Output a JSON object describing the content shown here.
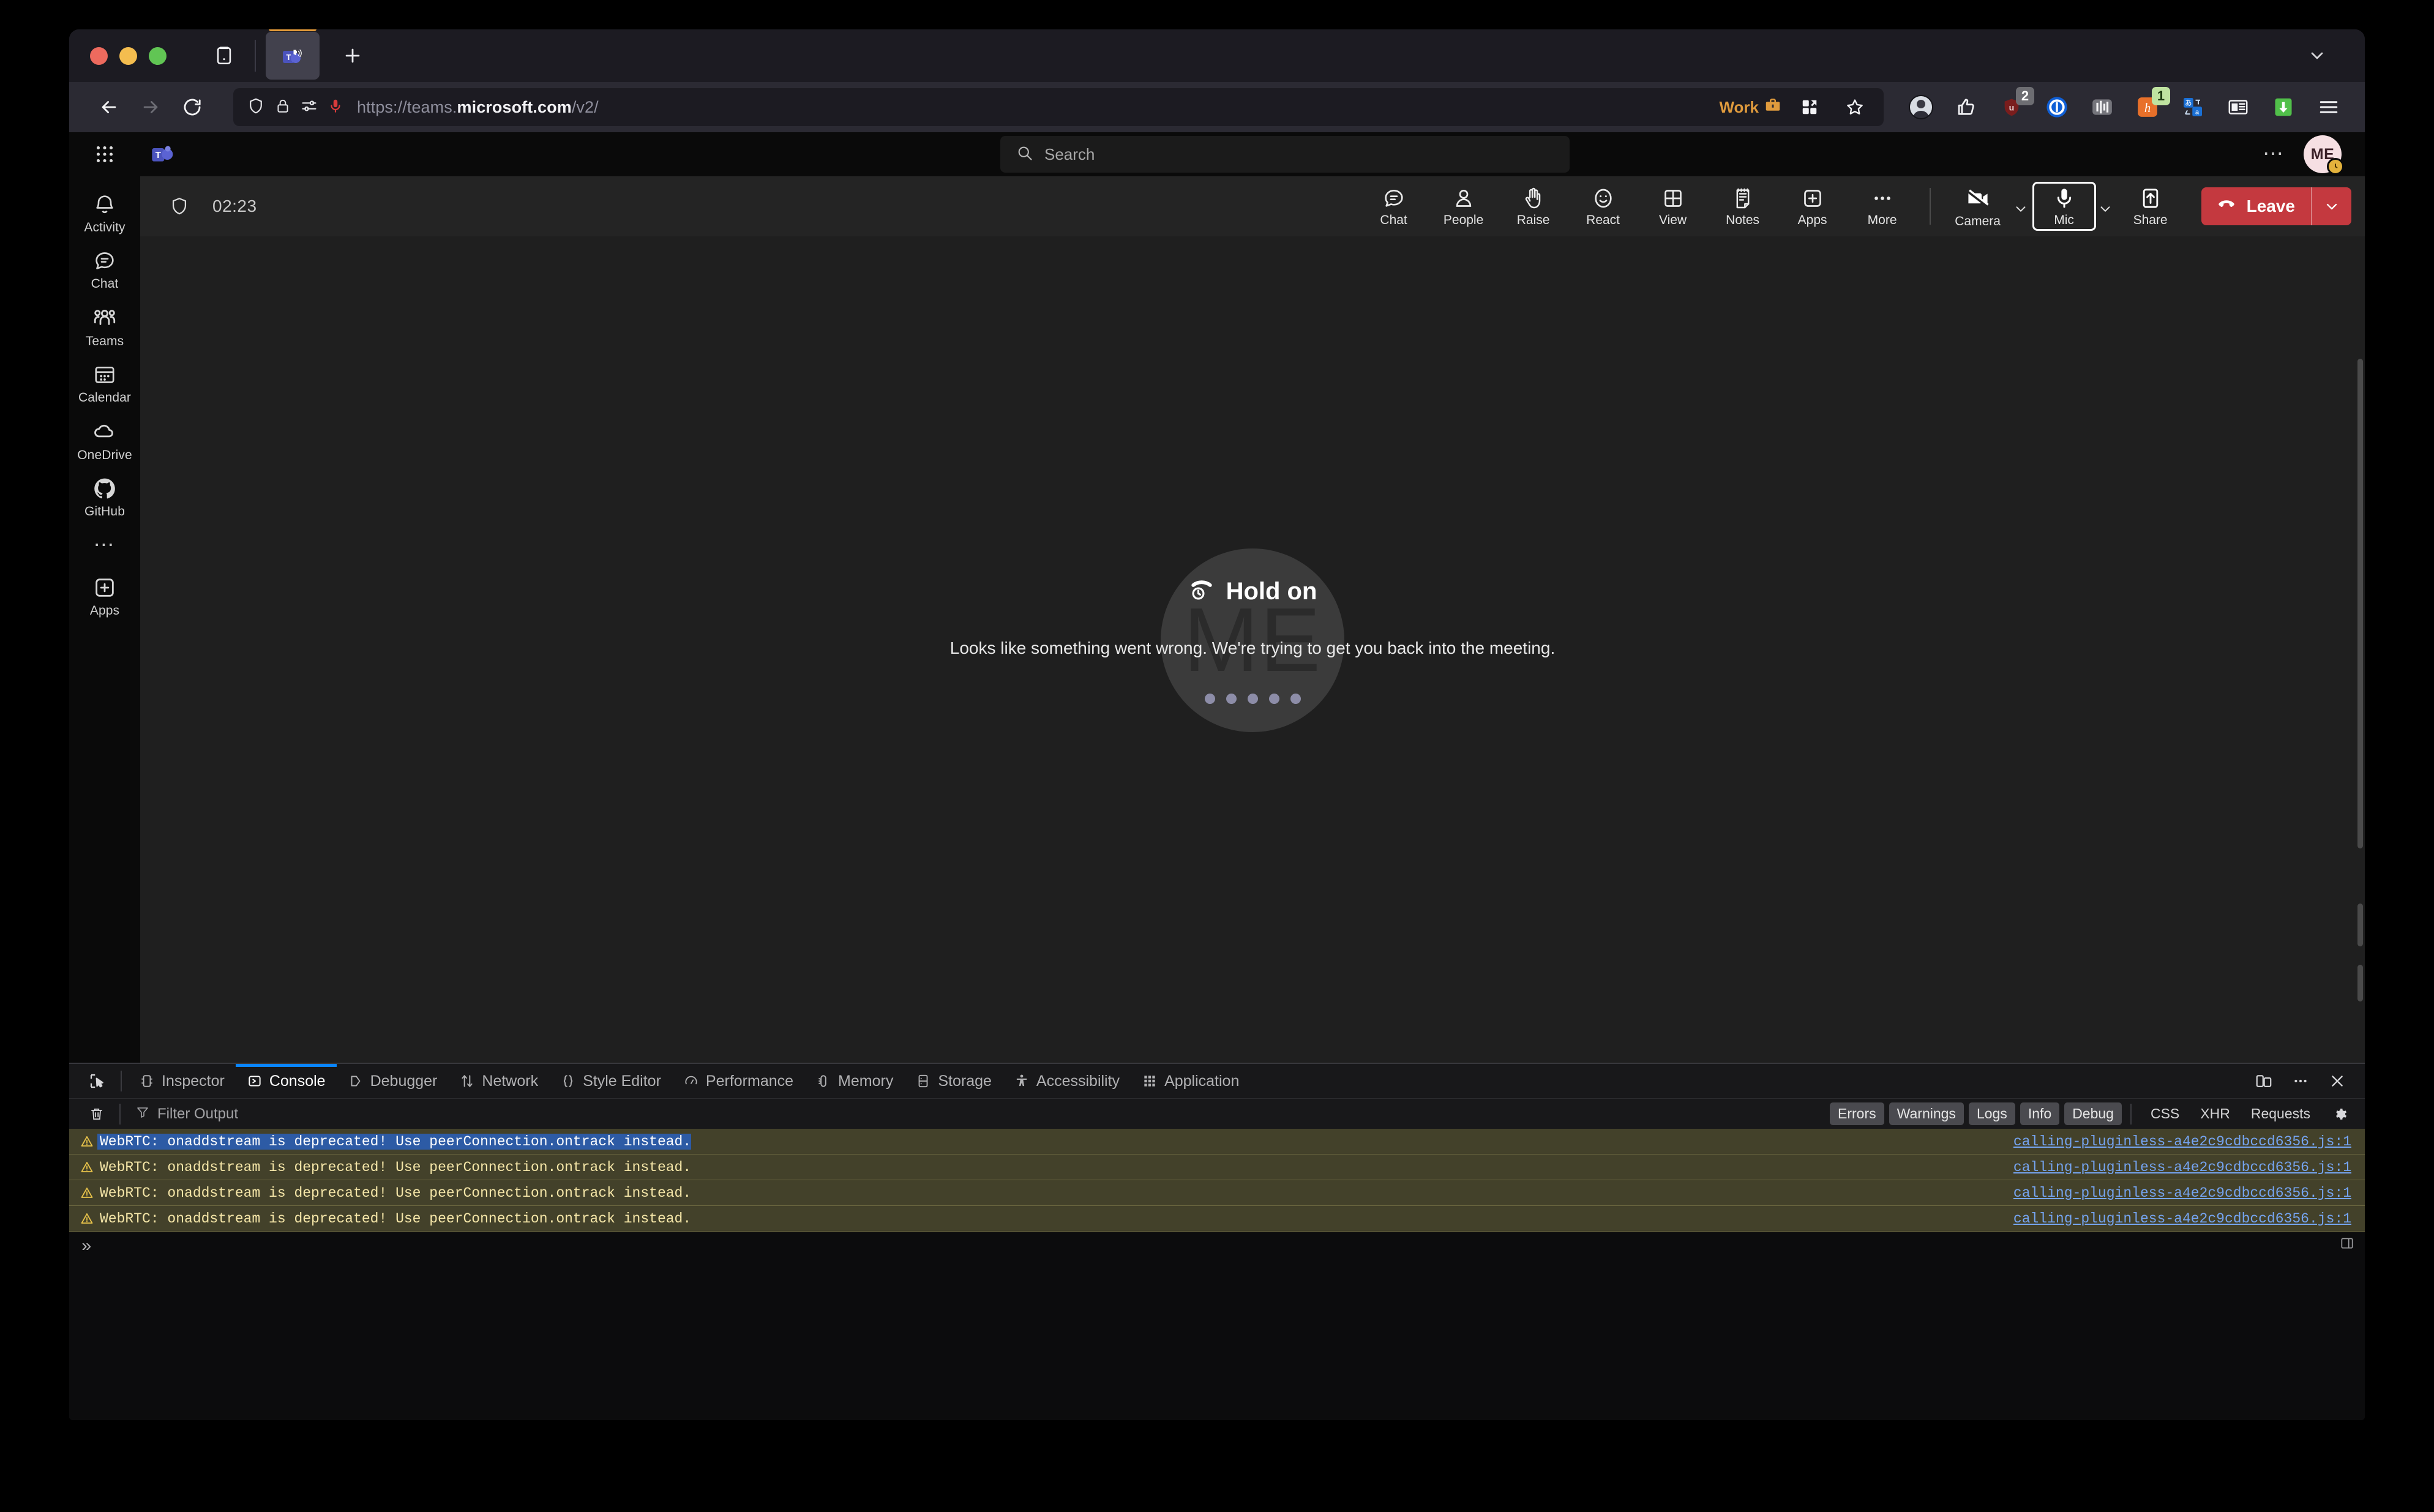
{
  "browser": {
    "tab": {
      "title": "Microsoft Teams",
      "audio_playing": true,
      "container": "Work"
    },
    "newtab_label": "+",
    "nav": {
      "back": "Back",
      "forward": "Forward",
      "reload": "Reload"
    },
    "url": {
      "scheme": "https://",
      "subdomain": "teams.",
      "domain": "microsoft.com",
      "path": "/v2/",
      "full": "https://teams.microsoft.com/v2/"
    },
    "identity_icons": [
      "shield-icon",
      "lock-icon",
      "permissions-icon",
      "microphone-active-icon"
    ],
    "urlbar_right": {
      "container_label": "Work",
      "container_icon": "briefcase-icon",
      "extension_icon": "extensions-icon",
      "bookmark_icon": "star-icon"
    },
    "toolbar_extensions": [
      {
        "name": "profile-avatar",
        "badge": ""
      },
      {
        "name": "thumbs-up-extension",
        "badge": ""
      },
      {
        "name": "ublock-origin-extension",
        "badge": "2"
      },
      {
        "name": "onepassword-extension",
        "badge": ""
      },
      {
        "name": "equalizer-extension",
        "badge": ""
      },
      {
        "name": "hypothesis-extension",
        "badge": "1"
      },
      {
        "name": "translate-extension",
        "badge": ""
      },
      {
        "name": "reader-extension",
        "badge": ""
      },
      {
        "name": "downloads-extension",
        "badge": ""
      }
    ],
    "menu_label": "Open application menu",
    "tabstrip_chevron": "List all tabs"
  },
  "teams": {
    "topbar": {
      "waffle": "App launcher",
      "logo": "Microsoft Teams",
      "search_placeholder": "Search",
      "more_label": "Settings and more",
      "avatar_initials": "ME",
      "avatar_status": "Away"
    },
    "rail": [
      {
        "label": "Activity",
        "icon": "bell-icon"
      },
      {
        "label": "Chat",
        "icon": "chat-bubble-icon"
      },
      {
        "label": "Teams",
        "icon": "people-group-icon"
      },
      {
        "label": "Calendar",
        "icon": "calendar-icon"
      },
      {
        "label": "OneDrive",
        "icon": "cloud-icon"
      },
      {
        "label": "GitHub",
        "icon": "github-icon"
      },
      {
        "label": "Apps",
        "icon": "plus-box-icon"
      }
    ],
    "rail_more": "More apps",
    "meeting": {
      "shield_label": "Meeting is encrypted",
      "timer": "02:23",
      "controls": [
        {
          "label": "Chat",
          "icon": "chat-bubble-icon"
        },
        {
          "label": "People",
          "icon": "person-icon"
        },
        {
          "label": "Raise",
          "icon": "raise-hand-icon"
        },
        {
          "label": "React",
          "icon": "smiley-icon"
        },
        {
          "label": "View",
          "icon": "grid-view-icon"
        },
        {
          "label": "Notes",
          "icon": "notes-icon"
        },
        {
          "label": "Apps",
          "icon": "plus-box-icon"
        },
        {
          "label": "More",
          "icon": "ellipsis-icon"
        }
      ],
      "camera": {
        "label": "Camera",
        "icon": "camera-off-icon",
        "state": "off"
      },
      "mic": {
        "label": "Mic",
        "icon": "microphone-icon",
        "state": "on",
        "focused": true
      },
      "share": {
        "label": "Share",
        "icon": "share-up-arrow-icon"
      },
      "leave": {
        "label": "Leave",
        "icon": "hangup-icon",
        "color": "#c4393f"
      }
    },
    "hold": {
      "icon": "call-on-hold-icon",
      "title": "Hold on",
      "subtitle": "Looks like something went wrong. We're trying to get you back into the meeting.",
      "avatar_initials": "ME",
      "dots": 5
    }
  },
  "devtools": {
    "picker_label": "Pick an element from the page",
    "tabs": [
      {
        "label": "Inspector",
        "icon": "inspector-icon",
        "active": false
      },
      {
        "label": "Console",
        "icon": "console-icon",
        "active": true
      },
      {
        "label": "Debugger",
        "icon": "debugger-icon",
        "active": false
      },
      {
        "label": "Network",
        "icon": "network-icon",
        "active": false
      },
      {
        "label": "Style Editor",
        "icon": "style-editor-icon",
        "active": false
      },
      {
        "label": "Performance",
        "icon": "performance-icon",
        "active": false
      },
      {
        "label": "Memory",
        "icon": "memory-icon",
        "active": false
      },
      {
        "label": "Storage",
        "icon": "storage-icon",
        "active": false
      },
      {
        "label": "Accessibility",
        "icon": "accessibility-icon",
        "active": false
      },
      {
        "label": "Application",
        "icon": "application-icon",
        "active": false
      }
    ],
    "tabbar_right": [
      {
        "name": "responsive-design-mode-icon"
      },
      {
        "name": "devtools-meatball-menu-icon"
      },
      {
        "name": "close-devtools-icon"
      }
    ],
    "filterbar": {
      "clear_label": "Clear console output",
      "filter_placeholder": "Filter Output",
      "filters": [
        {
          "label": "Errors",
          "active": true
        },
        {
          "label": "Warnings",
          "active": true
        },
        {
          "label": "Logs",
          "active": true
        },
        {
          "label": "Info",
          "active": true
        },
        {
          "label": "Debug",
          "active": true
        },
        {
          "label": "CSS",
          "active": false
        },
        {
          "label": "XHR",
          "active": false
        },
        {
          "label": "Requests",
          "active": false
        }
      ],
      "settings_label": "Console settings"
    },
    "messages": [
      {
        "level": "warning",
        "text": "WebRTC: onaddstream is deprecated! Use peerConnection.ontrack instead.",
        "source": "calling-pluginless-a4e2c9cdbccd6356.js:1",
        "selected": true
      },
      {
        "level": "warning",
        "text": "WebRTC: onaddstream is deprecated! Use peerConnection.ontrack instead.",
        "source": "calling-pluginless-a4e2c9cdbccd6356.js:1",
        "selected": false
      },
      {
        "level": "warning",
        "text": "WebRTC: onaddstream is deprecated! Use peerConnection.ontrack instead.",
        "source": "calling-pluginless-a4e2c9cdbccd6356.js:1",
        "selected": false
      },
      {
        "level": "warning",
        "text": "WebRTC: onaddstream is deprecated! Use peerConnection.ontrack instead.",
        "source": "calling-pluginless-a4e2c9cdbccd6356.js:1",
        "selected": false
      }
    ],
    "prompt_chevron": "»",
    "prompt_editor_toggle": "split-console-icon"
  }
}
